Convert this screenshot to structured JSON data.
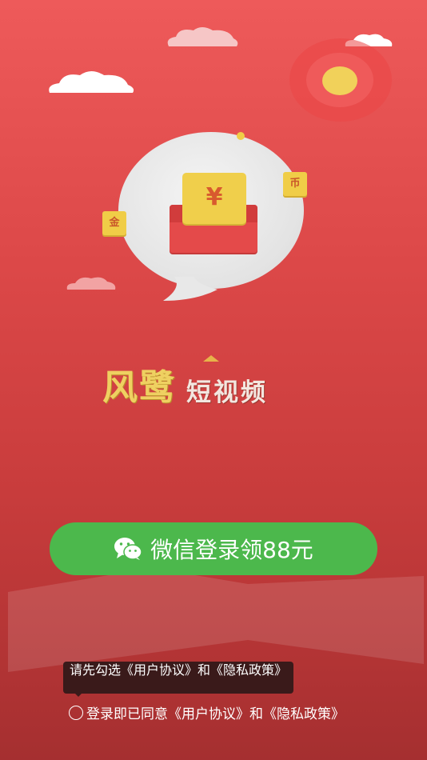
{
  "app": {
    "logo_main": "风鹭",
    "logo_sub": "短视频"
  },
  "illustration": {
    "bill_symbol": "¥",
    "coin_left": "金",
    "coin_right": "币"
  },
  "login": {
    "button_label": "微信登录领88元",
    "icon": "wechat-icon",
    "brand_color": "#4cb84c"
  },
  "agreement": {
    "tooltip_text": "请先勾选《用户协议》和《隐私政策》",
    "text": "登录即已同意《用户协议》和《隐私政策》"
  }
}
